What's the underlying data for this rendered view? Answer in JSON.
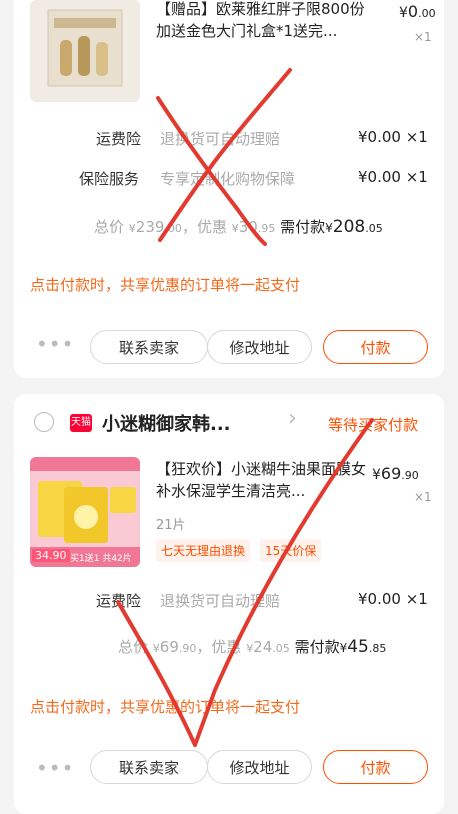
{
  "order1": {
    "product": {
      "title": "【赠品】欧莱雅红胖子限800份加送金色大门礼盒*1送完...",
      "price_symbol": "¥",
      "price_int": "0",
      "price_dec": ".00",
      "qty": "×1"
    },
    "shipping_insurance": {
      "label": "运费险",
      "desc": "退换货可自动理赔",
      "value": "¥0.00 ×1"
    },
    "insurance_service": {
      "label": "保险服务",
      "desc": "专享定制化购物保障",
      "value": "¥0.00 ×1"
    },
    "summary": {
      "total_label": "总价",
      "total_symbol": "¥",
      "total_int": "239",
      "total_dec": ".00",
      "discount_label": "，优惠",
      "discount_symbol": "¥",
      "discount_int": "30",
      "discount_dec": ".95",
      "need_label": "需付款",
      "need_symbol": "¥",
      "need_int": "208",
      "need_dec": ".05"
    },
    "notice": "点击付款时，共享优惠的订单将一起支付",
    "more": "•••",
    "buttons": {
      "contact": "联系卖家",
      "address": "修改地址",
      "pay": "付款"
    }
  },
  "order2": {
    "shop": {
      "badge": "天猫",
      "name": "小迷糊御家韩...",
      "chevron": "›",
      "status": "等待买家付款"
    },
    "product": {
      "title": "【狂欢价】小迷糊牛油果面膜女补水保湿学生清洁亮...",
      "variant": "21片",
      "price_symbol": "¥",
      "price_int": "69",
      "price_dec": ".90",
      "qty": "×1",
      "tags": [
        "七天无理由退换",
        "15天价保"
      ],
      "thumb_price": "34.90",
      "thumb_banner": "买1送1 共42片"
    },
    "shipping_insurance": {
      "label": "运费险",
      "desc": "退换货可自动理赔",
      "value": "¥0.00 ×1"
    },
    "summary": {
      "total_label": "总价",
      "total_symbol": "¥",
      "total_int": "69",
      "total_dec": ".90",
      "discount_label": "，优惠",
      "discount_symbol": "¥",
      "discount_int": "24",
      "discount_dec": ".05",
      "need_label": "需付款",
      "need_symbol": "¥",
      "need_int": "45",
      "need_dec": ".85"
    },
    "notice": "点击付款时，共享优惠的订单将一起支付",
    "more": "•••",
    "buttons": {
      "contact": "联系卖家",
      "address": "修改地址",
      "pay": "付款"
    }
  },
  "colors": {
    "accent": "#ff5000",
    "notice": "#f26a1b",
    "annotation": "#e23a2e"
  }
}
